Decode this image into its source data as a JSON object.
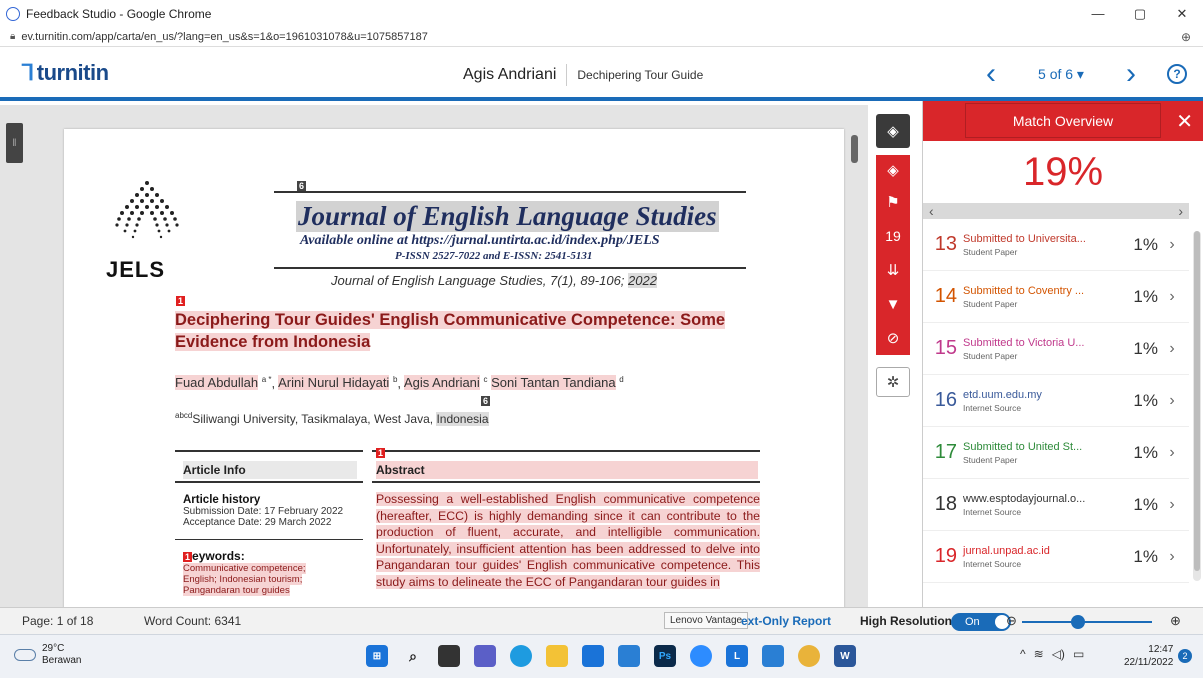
{
  "window": {
    "title": "Feedback Studio - Google Chrome",
    "url": "ev.turnitin.com/app/carta/en_us/?lang=en_us&s=1&o=1961031078&u=1075857187"
  },
  "header": {
    "logo": "turnitin",
    "author": "Agis Andriani",
    "doc_title": "Dechipering Tour Guide",
    "page_indicator": "5 of 6 ▾"
  },
  "document": {
    "journal_title": "Journal of English Language Studies",
    "journal_sub": "Available online at https://jurnal.untirta.ac.id/index.php/JELS",
    "issn": "P-ISSN 2527-7022 and E-ISSN: 2541-5131",
    "logo_text": "JELS",
    "citation_pre": "Journal of English Language Studies, 7(1), 89-106; ",
    "citation_year": "2022",
    "marker_6a": "6",
    "marker_1a": "1",
    "marker_6b": "6",
    "marker_1b": "1",
    "marker_1c": "1",
    "paper_title": "Deciphering Tour Guides' English Communicative Competence: Some Evidence from Indonesia",
    "author_1": "Fuad Abdullah",
    "author_1_sup": "a *",
    "author_2": "Arini Nurul Hidayati",
    "author_2_sup": "b",
    "author_3": "Agis Andriani",
    "author_3_sup": "c",
    "author_4": "Soni Tantan Tandiana",
    "author_4_sup": "d",
    "affil_sup": "abcd",
    "affil_text": "Siliwangi University, Tasikmalaya, West Java, ",
    "affil_country": "Indonesia",
    "article_info_heading": "Article Info",
    "abstract_heading": "Abstract",
    "history_heading": "Article history",
    "submission": "Submission Date: 17 February 2022",
    "acceptance": "Acceptance Date: 29 March 2022",
    "keywords_heading": "eywords:",
    "keywords": [
      "Communicative competence;",
      "English; Indonesian tourism;",
      "Pangandaran tour guides"
    ],
    "abstract_text": "Possessing a well-established English communicative competence (hereafter, ECC) is highly demanding since it can contribute to the production of fluent, accurate, and intelligible communication. Unfortunately, insufficient attention has been addressed to delve into Pangandaran tour guides' English communicative competence. This study aims to delineate the ECC of Pangandaran tour guides in"
  },
  "toolbar": {
    "match_count": "19"
  },
  "panel": {
    "tab": "Match Overview",
    "percentage": "19%",
    "matches": [
      {
        "num": "13",
        "title": "Submitted to Universita...",
        "type": "Student Paper",
        "pct": "1%",
        "color": "#c0392b"
      },
      {
        "num": "14",
        "title": "Submitted to Coventry ...",
        "type": "Student Paper",
        "pct": "1%",
        "color": "#d35400"
      },
      {
        "num": "15",
        "title": "Submitted to Victoria U...",
        "type": "Student Paper",
        "pct": "1%",
        "color": "#c0398b"
      },
      {
        "num": "16",
        "title": "etd.uum.edu.my",
        "type": "Internet Source",
        "pct": "1%",
        "color": "#3a5a9a"
      },
      {
        "num": "17",
        "title": "Submitted to United St...",
        "type": "Student Paper",
        "pct": "1%",
        "color": "#2e8b3a"
      },
      {
        "num": "18",
        "title": "www.esptodayjournal.o...",
        "type": "Internet Source",
        "pct": "1%",
        "color": "#333333"
      },
      {
        "num": "19",
        "title": "jurnal.unpad.ac.id",
        "type": "Internet Source",
        "pct": "1%",
        "color": "#d9262a"
      }
    ]
  },
  "status": {
    "page": "Page: 1 of 18",
    "words": "Word Count: 6341",
    "tooltip": "Lenovo Vantage",
    "text_only": "ext-Only Report",
    "high_res": "High Resolution",
    "toggle": "On"
  },
  "taskbar": {
    "temp": "29°C",
    "weather": "Berawan",
    "time": "12:47",
    "date": "22/11/2022",
    "notif": "2"
  }
}
